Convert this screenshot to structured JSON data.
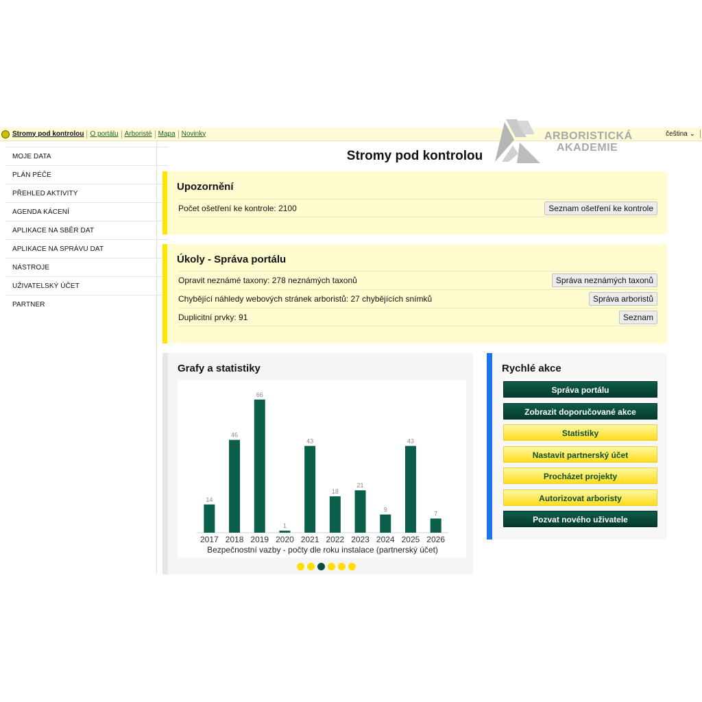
{
  "topnav": {
    "brand": "Stromy pod kontrolou",
    "links": [
      "O portálu",
      "Arboristé",
      "Mapa",
      "Novinky"
    ],
    "language": "čeština"
  },
  "academy_logo": {
    "line1": "ARBORISTICKÁ",
    "line2": "AKADEMIE"
  },
  "sidebar": {
    "items": [
      {
        "label": "MOJE DATA"
      },
      {
        "label": "PLÁN PÉČE"
      },
      {
        "label": "PŘEHLED AKTIVITY"
      },
      {
        "label": "AGENDA KÁCENÍ"
      },
      {
        "label": "APLIKACE NA SBĚR DAT"
      },
      {
        "label": "APLIKACE NA SPRÁVU DAT"
      },
      {
        "label": "NÁSTROJE"
      },
      {
        "label": "UŽIVATELSKÝ ÚČET"
      },
      {
        "label": "PARTNER"
      }
    ]
  },
  "page_title": "Stromy pod kontrolou",
  "alerts": {
    "title": "Upozornění",
    "rows": [
      {
        "text": "Počet ošetření ke kontrole: 2100",
        "button": "Seznam ošetření ke kontrole"
      }
    ]
  },
  "tasks": {
    "title": "Úkoly - Správa portálu",
    "rows": [
      {
        "text": "Opravit neznámé taxony: 278 neznámých taxonů",
        "button": "Správa neznámých taxonů"
      },
      {
        "text": "Chybějící náhledy webových stránek arboristů: 27 chybějících snímků",
        "button": "Správa arboristů"
      },
      {
        "text": "Duplicitní prvky: 91",
        "button": "Seznam"
      }
    ]
  },
  "charts": {
    "title": "Grafy a statistiky",
    "carousel": {
      "count": 6,
      "active": 2
    }
  },
  "chart_data": {
    "type": "bar",
    "categories": [
      "2017",
      "2018",
      "2019",
      "2020",
      "2021",
      "2022",
      "2023",
      "2024",
      "2025",
      "2026"
    ],
    "values": [
      14,
      46,
      66,
      1,
      43,
      18,
      21,
      9,
      43,
      7
    ],
    "xlabel": "Bezpečnostní vazby - počty dle roku instalace (partnerský účet)",
    "ylim": [
      0,
      70
    ],
    "grid": false,
    "color": "#0b5e4a"
  },
  "quick_actions": {
    "title": "Rychlé akce",
    "items": [
      {
        "label": "Správa portálu",
        "style": "dark"
      },
      {
        "label": "Zobrazit doporučované akce",
        "style": "dark"
      },
      {
        "label": "Statistiky",
        "style": "light"
      },
      {
        "label": "Nastavit partnerský účet",
        "style": "light"
      },
      {
        "label": "Procházet projekty",
        "style": "light"
      },
      {
        "label": "Autorizovat arboristy",
        "style": "light"
      },
      {
        "label": "Pozvat nového uživatele",
        "style": "dark"
      }
    ]
  },
  "colors": {
    "accent_yellow": "#ffe600",
    "accent_blue": "#1a75e8",
    "brand_green": "#0b5e4a",
    "panel_yellow": "#fffdd0"
  }
}
